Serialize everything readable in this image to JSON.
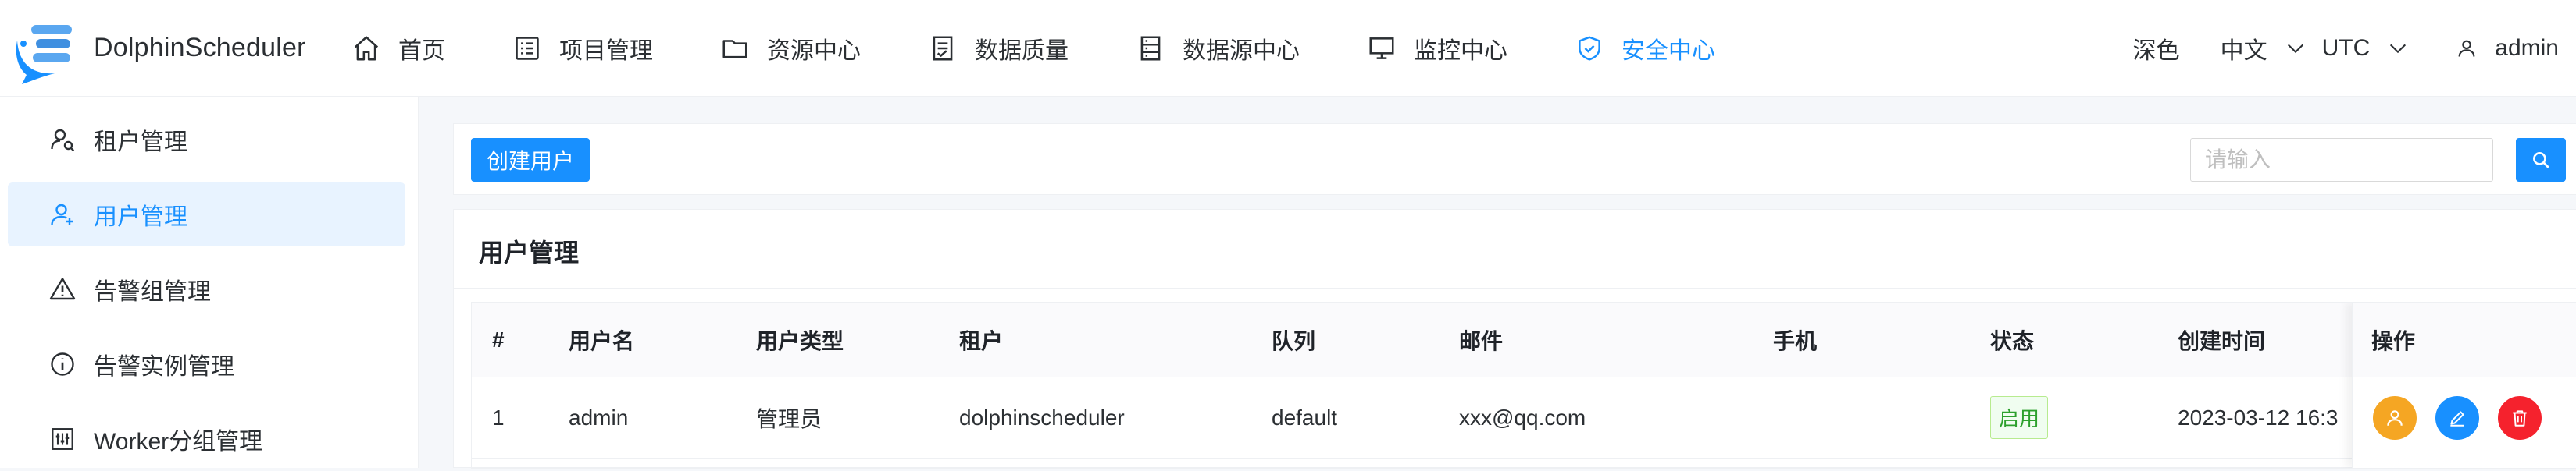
{
  "app": {
    "title": "DolphinScheduler"
  },
  "nav": {
    "items": [
      {
        "label": "首页",
        "icon": "home-icon"
      },
      {
        "label": "项目管理",
        "icon": "project-icon"
      },
      {
        "label": "资源中心",
        "icon": "folder-icon"
      },
      {
        "label": "数据质量",
        "icon": "data-quality-icon"
      },
      {
        "label": "数据源中心",
        "icon": "datasource-icon"
      },
      {
        "label": "监控中心",
        "icon": "monitor-icon"
      },
      {
        "label": "安全中心",
        "icon": "shield-icon",
        "active": true
      }
    ]
  },
  "toolbar_right": {
    "theme": "深色",
    "language": "中文",
    "timezone": "UTC",
    "user": "admin"
  },
  "sidebar": {
    "items": [
      {
        "label": "租户管理",
        "icon": "tenant-icon"
      },
      {
        "label": "用户管理",
        "icon": "user-icon",
        "active": true
      },
      {
        "label": "告警组管理",
        "icon": "warning-icon"
      },
      {
        "label": "告警实例管理",
        "icon": "info-icon"
      },
      {
        "label": "Worker分组管理",
        "icon": "worker-group-icon"
      }
    ]
  },
  "actions": {
    "create_label": "创建用户",
    "search_placeholder": "请输入"
  },
  "table": {
    "title": "用户管理",
    "columns": [
      "#",
      "用户名",
      "用户类型",
      "租户",
      "队列",
      "邮件",
      "手机",
      "状态",
      "创建时间",
      "操作"
    ],
    "rows": [
      {
        "index": "1",
        "username": "admin",
        "user_type": "管理员",
        "tenant": "dolphinscheduler",
        "queue": "default",
        "email": "xxx@qq.com",
        "phone": "",
        "status": "启用",
        "created": "2023-03-12 16:3"
      }
    ]
  },
  "colors": {
    "accent": "#1890ff",
    "tenant_action": "#f5a623",
    "delete_action": "#f5222d",
    "enabled_status": "#2ca02c"
  }
}
